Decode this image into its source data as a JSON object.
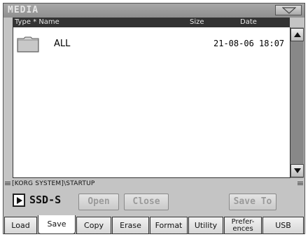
{
  "window": {
    "title": "MEDIA"
  },
  "columns": {
    "type_name": "Type * Name",
    "size": "Size",
    "date": "Date"
  },
  "files": [
    {
      "icon": "folder-icon",
      "name": "ALL",
      "size": "",
      "date": "21-08-06 18:07"
    }
  ],
  "path": "[KORG SYSTEM]\\STARTUP",
  "device": {
    "label": "SSD-S"
  },
  "actions": {
    "open": "Open",
    "close": "Close",
    "save_to": "Save To"
  },
  "tabs": [
    {
      "label": "Load",
      "active": false
    },
    {
      "label": "Save",
      "active": true
    },
    {
      "label": "Copy",
      "active": false
    },
    {
      "label": "Erase",
      "active": false
    },
    {
      "label": "Format",
      "active": false
    },
    {
      "label": "Utility",
      "active": false
    },
    {
      "label": "Prefer-\nences",
      "active": false
    },
    {
      "label": "USB",
      "active": false
    }
  ]
}
